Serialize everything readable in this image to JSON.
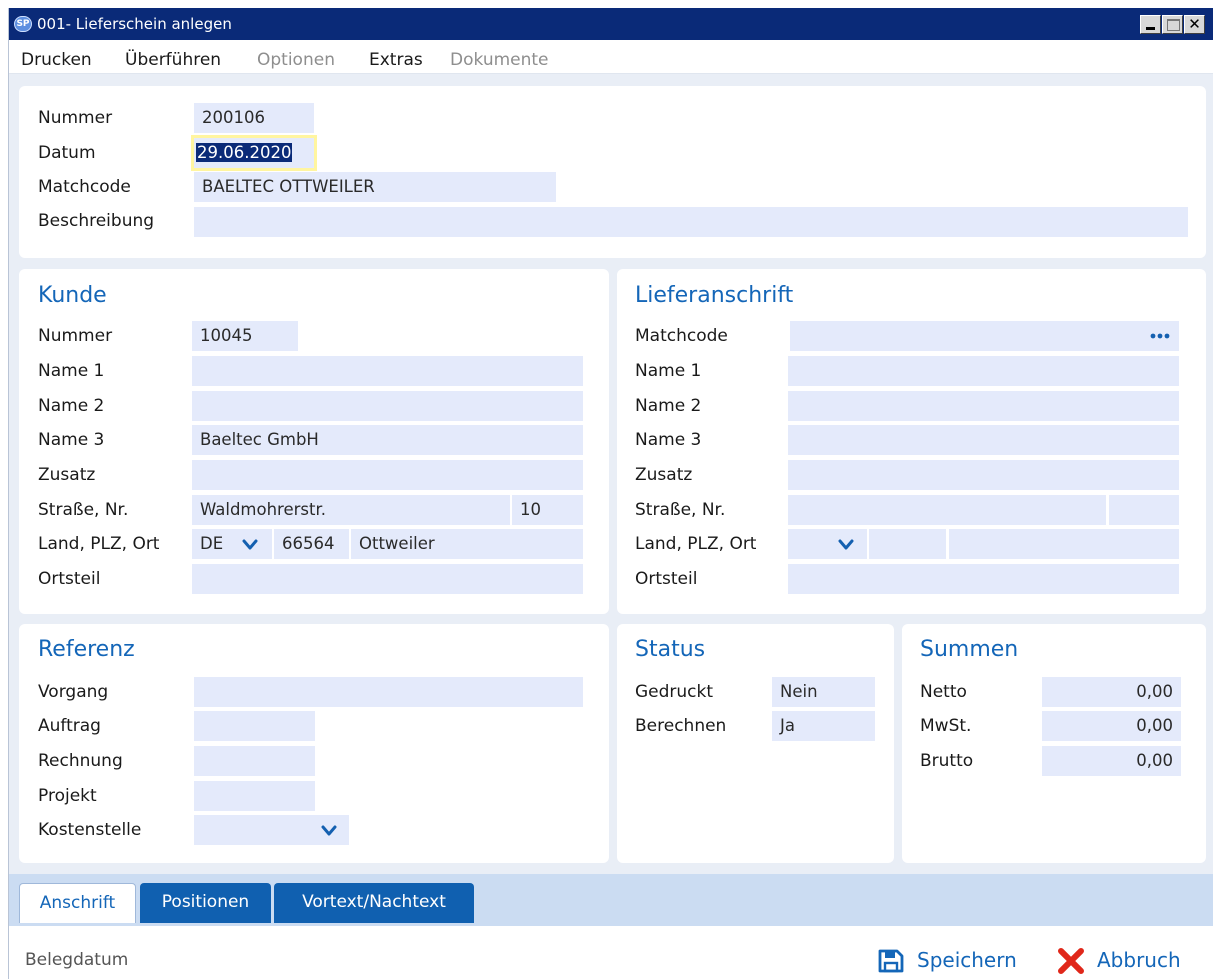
{
  "window": {
    "title": "001- Lieferschein anlegen",
    "app_icon": "app-logo-icon",
    "close_glyph": "✕"
  },
  "menu": {
    "items": [
      {
        "label": "Drucken",
        "enabled": true
      },
      {
        "label": "Überführen",
        "enabled": true
      },
      {
        "label": "Optionen",
        "enabled": false
      },
      {
        "label": "Extras",
        "enabled": true
      },
      {
        "label": "Dokumente",
        "enabled": false
      }
    ]
  },
  "header": {
    "nummer_label": "Nummer",
    "nummer_value": "200106",
    "datum_label": "Datum",
    "datum_value": "29.06.2020",
    "matchcode_label": "Matchcode",
    "matchcode_value": "BAELTEC OTTWEILER",
    "beschreibung_label": "Beschreibung",
    "beschreibung_value": ""
  },
  "kunde": {
    "title": "Kunde",
    "nummer_label": "Nummer",
    "nummer_value": "10045",
    "name1_label": "Name 1",
    "name1_value": "",
    "name2_label": "Name 2",
    "name2_value": "",
    "name3_label": "Name 3",
    "name3_value": "Baeltec GmbH",
    "zusatz_label": "Zusatz",
    "zusatz_value": "",
    "strasse_label": "Straße, Nr.",
    "strasse_value": "Waldmohrerstr.",
    "hausnr_value": "10",
    "land_label": "Land, PLZ, Ort",
    "land_value": "DE",
    "plz_value": "66564",
    "ort_value": "Ottweiler",
    "ortsteil_label": "Ortsteil",
    "ortsteil_value": ""
  },
  "lieferanschrift": {
    "title": "Lieferanschrift",
    "matchcode_label": "Matchcode",
    "matchcode_value": "",
    "name1_label": "Name 1",
    "name2_label": "Name 2",
    "name3_label": "Name 3",
    "zusatz_label": "Zusatz",
    "strasse_label": "Straße, Nr.",
    "land_label": "Land, PLZ, Ort",
    "ortsteil_label": "Ortsteil"
  },
  "referenz": {
    "title": "Referenz",
    "vorgang_label": "Vorgang",
    "auftrag_label": "Auftrag",
    "rechnung_label": "Rechnung",
    "projekt_label": "Projekt",
    "kostenstelle_label": "Kostenstelle"
  },
  "status": {
    "title": "Status",
    "gedruckt_label": "Gedruckt",
    "gedruckt_value": "Nein",
    "berechnen_label": "Berechnen",
    "berechnen_value": "Ja"
  },
  "summen": {
    "title": "Summen",
    "netto_label": "Netto",
    "netto_value": "0,00",
    "mwst_label": "MwSt.",
    "mwst_value": "0,00",
    "brutto_label": "Brutto",
    "brutto_value": "0,00"
  },
  "tabs": [
    {
      "label": "Anschrift",
      "active": true
    },
    {
      "label": "Positionen",
      "active": false
    },
    {
      "label": "Vortext/Nachtext",
      "active": false
    }
  ],
  "footer": {
    "status_text": "Belegdatum",
    "save_label": "Speichern",
    "save_icon": "floppy-disk-icon",
    "cancel_label": "Abbruch",
    "cancel_icon": "close-x-icon"
  },
  "colors": {
    "accent": "#1466b8",
    "titlebar": "#0a2a78",
    "field": "#e4eafb",
    "tabbar": "#cbdcf2",
    "cancel": "#e0271a"
  }
}
